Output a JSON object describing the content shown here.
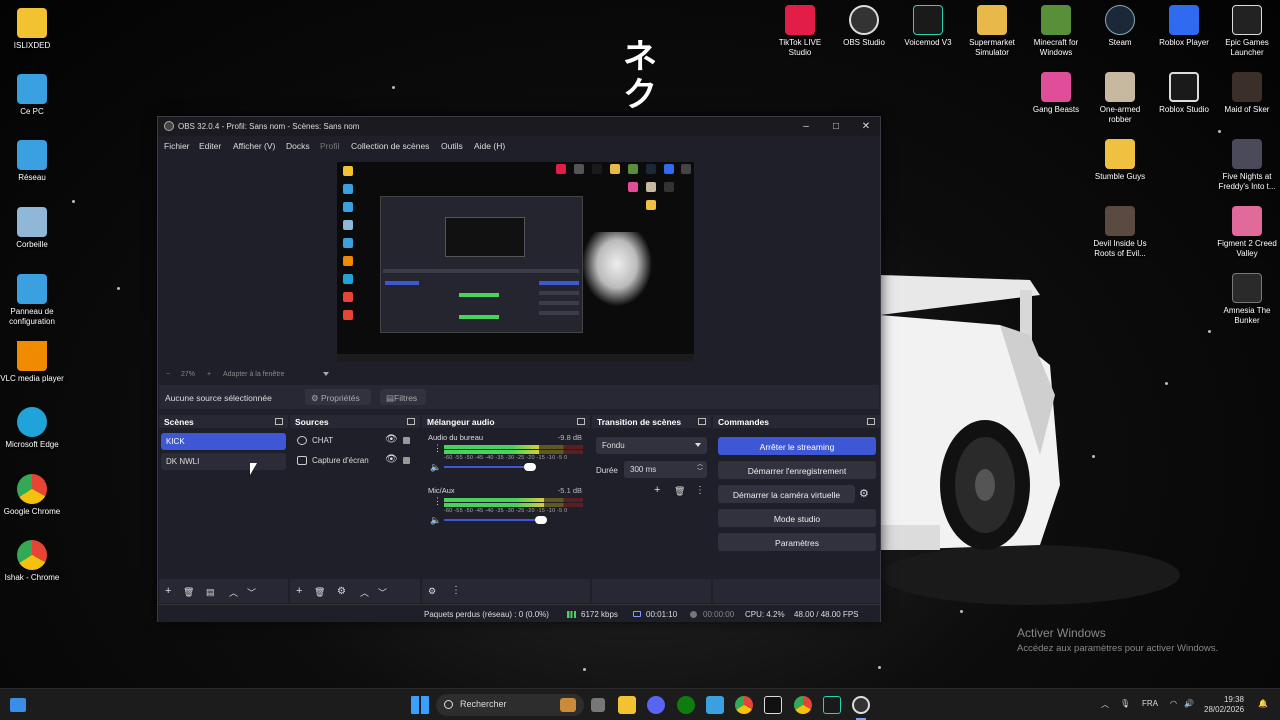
{
  "desktop": {
    "left_icons": [
      {
        "label": "ISLIXDED",
        "icon": "folder-icon",
        "color": "#f2c230"
      },
      {
        "label": "Ce PC",
        "icon": "computer-icon",
        "color": "#3aa0e0"
      },
      {
        "label": "Réseau",
        "icon": "network-icon",
        "color": "#3aa0e0"
      },
      {
        "label": "Corbeille",
        "icon": "recycle-bin-icon",
        "color": "#8fb7d8"
      },
      {
        "label": "Panneau de configuration",
        "icon": "control-panel-icon",
        "color": "#3aa0e0"
      },
      {
        "label": "VLC media player",
        "icon": "vlc-icon",
        "color": "#f08a00"
      },
      {
        "label": "Microsoft Edge",
        "icon": "edge-icon",
        "color": "#1fa3d8"
      },
      {
        "label": "Google Chrome",
        "icon": "chrome-icon",
        "color": "#e84435"
      },
      {
        "label": "Ishak - Chrome",
        "icon": "chrome-icon",
        "color": "#e84435"
      }
    ],
    "top_icons": [
      {
        "label": "TikTok LIVE Studio",
        "icon": "tiktok-icon",
        "color": "#e11d48"
      },
      {
        "label": "OBS Studio",
        "icon": "obs-icon",
        "color": "#333333"
      },
      {
        "label": "Voicemod V3",
        "icon": "voicemod-icon",
        "color": "#1a1a1a"
      },
      {
        "label": "Supermarket Simulator",
        "icon": "game-icon",
        "color": "#e8b84a"
      },
      {
        "label": "Minecraft for Windows",
        "icon": "minecraft-icon",
        "color": "#5a8f3a"
      },
      {
        "label": "Steam",
        "icon": "steam-icon",
        "color": "#1b2838"
      },
      {
        "label": "Roblox Player",
        "icon": "roblox-icon",
        "color": "#2e6bf0"
      },
      {
        "label": "Epic Games Launcher",
        "icon": "epic-games-icon",
        "color": "#222222"
      }
    ],
    "right_icons": [
      {
        "label": "Gang Beasts",
        "icon": "gang-beasts-icon",
        "color": "#e04e9a"
      },
      {
        "label": "One-armed robber",
        "icon": "game-icon",
        "color": "#c7b8a0"
      },
      {
        "label": "Roblox Studio",
        "icon": "roblox-studio-icon",
        "color": "#1a1a1a"
      },
      {
        "label": "Maid of Sker",
        "icon": "game-icon",
        "color": "#3b2f2a"
      },
      {
        "label": "Stumble Guys",
        "icon": "game-icon",
        "color": "#f0c040"
      },
      {
        "label": "Five Nights at Freddy's Into t...",
        "icon": "game-icon",
        "color": "#4a4a5a"
      },
      {
        "label": "Devil Inside Us Roots of Evil...",
        "icon": "game-icon",
        "color": "#5a4a40"
      },
      {
        "label": "Figment 2 Creed Valley",
        "icon": "game-icon",
        "color": "#e06a9a"
      },
      {
        "label": "Amnesia The Bunker",
        "icon": "game-icon",
        "color": "#2a2a2a"
      }
    ],
    "wallpaper_text": "ネク",
    "activate_windows": {
      "title": "Activer Windows",
      "subtitle": "Accédez aux paramètres pour activer Windows."
    }
  },
  "obs": {
    "title": "OBS 32.0.4 - Profil: Sans nom - Scènes: Sans nom",
    "menu": [
      "Fichier",
      "Editer",
      "Afficher (V)",
      "Docks",
      "Profil",
      "Collection de scènes",
      "Outils",
      "Aide (H)"
    ],
    "zoom": {
      "minus": "−",
      "value": "27%",
      "plus": "+",
      "fit": "Adapter à la fenêtre"
    },
    "source_bar": {
      "label": "Aucune source sélectionnée",
      "properties": "Propriétés",
      "filters": "Filtres"
    },
    "scenes": {
      "title": "Scènes",
      "items": [
        "KICK",
        "DK NWLI"
      ]
    },
    "sources": {
      "title": "Sources",
      "items": [
        "CHAT",
        "Capture d'écran"
      ]
    },
    "mixer": {
      "title": "Mélangeur audio",
      "channels": [
        {
          "name": "Audio du bureau",
          "db": "-9.8 dB",
          "level": 0.68,
          "volume": 0.62
        },
        {
          "name": "Mic/Aux",
          "db": "-5.1 dB",
          "level": 0.72,
          "volume": 0.7
        }
      ],
      "scale": "-60 -55 -50 -45 -40 -35 -30 -25 -20 -15 -10 -5 0"
    },
    "transitions": {
      "title": "Transition de scènes",
      "type": "Fondu",
      "duration_label": "Durée",
      "duration": "300 ms"
    },
    "controls": {
      "title": "Commandes",
      "stop_stream": "Arrêter le streaming",
      "start_recording": "Démarrer l'enregistrement",
      "start_virtualcam": "Démarrer la caméra virtuelle",
      "studio_mode": "Mode studio",
      "settings": "Paramètres"
    },
    "status": {
      "dropped": "Paquets perdus (réseau) : 0 (0.0%)",
      "bitrate": "6172 kbps",
      "stream_time": "00:01:10",
      "rec_time": "00:00:00",
      "cpu": "CPU: 4.2%",
      "fps": "48.00 / 48.00 FPS"
    }
  },
  "taskbar": {
    "search": "Rechercher",
    "lang": "FRA",
    "time": "19:38",
    "date": "28/02/2026"
  }
}
